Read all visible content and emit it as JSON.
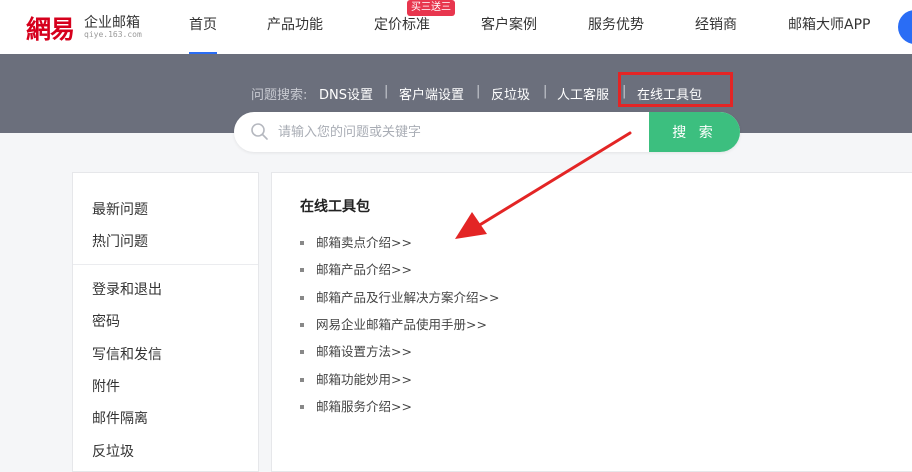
{
  "brand": {
    "mark": "網易",
    "name": "企业邮箱",
    "domain": "qiye.163.com"
  },
  "nav": {
    "items": [
      {
        "label": "首页",
        "active": true
      },
      {
        "label": "产品功能"
      },
      {
        "label": "定价标准"
      },
      {
        "label": "客户案例"
      },
      {
        "label": "服务优势"
      },
      {
        "label": "经销商"
      },
      {
        "label": "邮箱大师APP"
      }
    ],
    "promo_badge": "买三送三"
  },
  "quick_search": {
    "prefix": "问题搜索:",
    "links": [
      "DNS设置",
      "客户端设置",
      "反垃圾",
      "人工客服",
      "在线工具包"
    ],
    "highlighted": "在线工具包"
  },
  "search": {
    "placeholder": "请输入您的问题或关键字",
    "button": "搜 索"
  },
  "sidebar": {
    "top_items": [
      "最新问题",
      "热门问题"
    ],
    "items": [
      "登录和退出",
      "密码",
      "写信和发信",
      "附件",
      "邮件隔离",
      "反垃圾"
    ]
  },
  "main": {
    "title": "在线工具包",
    "links": [
      "邮箱卖点介绍>>",
      "邮箱产品介绍>>",
      "邮箱产品及行业解决方案介绍>>",
      "网易企业邮箱产品使用手册>>",
      "邮箱设置方法>>",
      "邮箱功能妙用>>",
      "邮箱服务介绍>>"
    ]
  },
  "colors": {
    "accent_blue": "#2a6df5",
    "search_green": "#3cbf7f",
    "annotation_red": "#e32525",
    "brand_red": "#d6001c"
  }
}
